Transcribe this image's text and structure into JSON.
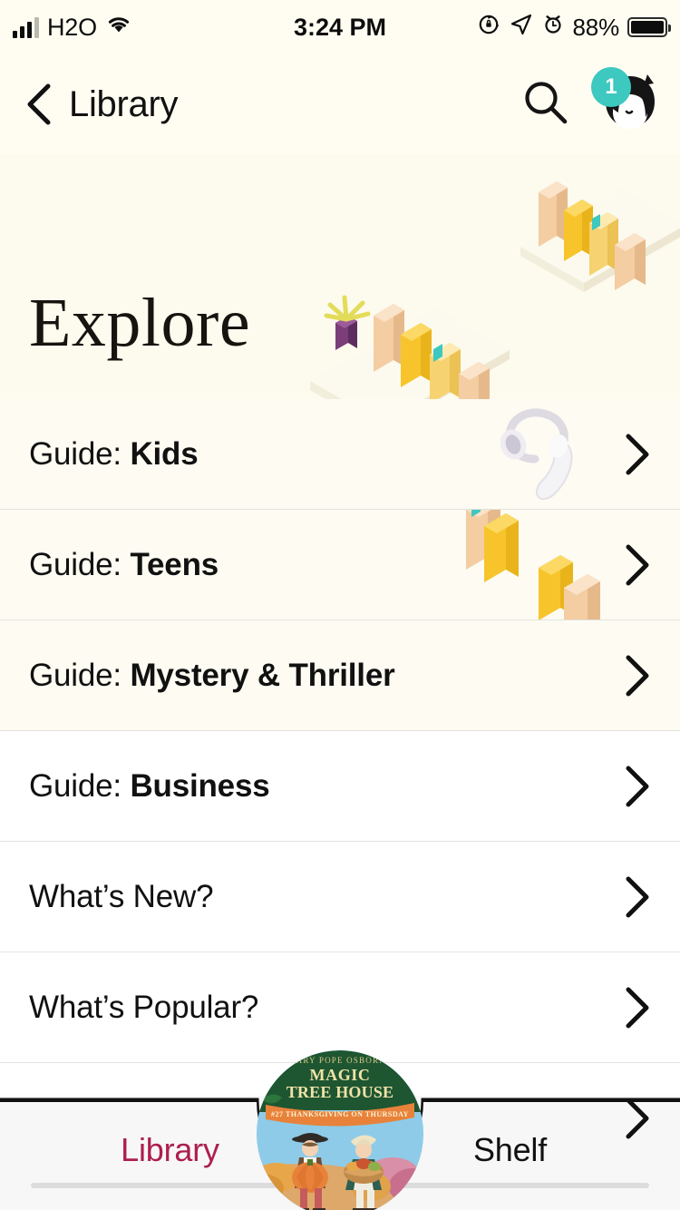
{
  "status_bar": {
    "carrier": "H2O",
    "time": "3:24 PM",
    "battery_percent": "88%",
    "icons": [
      "signal-bars-icon",
      "wifi-icon",
      "rotation-lock-icon",
      "location-arrow-icon",
      "alarm-clock-icon",
      "battery-icon"
    ]
  },
  "nav": {
    "back_label": "Library",
    "back_icon": "chevron-left-icon",
    "search_icon": "search-icon",
    "avatar_icon": "avatar-icon",
    "avatar_badge": "1",
    "badge_color": "#3DC8C0"
  },
  "hero": {
    "title": "Explore",
    "art_icon": "isometric-bookshelf-illustration",
    "background": "#FDFAEE"
  },
  "list": {
    "rows": [
      {
        "prefix": "Guide: ",
        "name": "Kids",
        "chevron": "chevron-right-icon",
        "art": "headphones-illustration",
        "bg": "cream"
      },
      {
        "prefix": "Guide: ",
        "name": "Teens",
        "chevron": "chevron-right-icon",
        "art": "books-illustration",
        "bg": "cream"
      },
      {
        "prefix": "Guide: ",
        "name": "Mystery & Thriller",
        "chevron": "chevron-right-icon",
        "art": "",
        "bg": "cream"
      },
      {
        "prefix": "Guide: ",
        "name": "Business",
        "chevron": "chevron-right-icon",
        "art": "",
        "bg": "plain"
      },
      {
        "prefix": "",
        "name": "What’s New?",
        "chevron": "chevron-right-icon",
        "art": "",
        "bg": "plain"
      },
      {
        "prefix": "",
        "name": "What’s Popular?",
        "chevron": "chevron-right-icon",
        "art": "",
        "bg": "plain"
      }
    ]
  },
  "tabbar": {
    "tabs": [
      {
        "label": "Library",
        "active": true,
        "color": "#AD1E4F"
      },
      {
        "label": "Shelf",
        "active": false,
        "color": "#111111"
      }
    ],
    "now_playing": {
      "icon": "book-cover-thumbnail",
      "series": "MAGIC TREE HOUSE",
      "author_line": "MARY POPE OSBORNE",
      "subtitle": "#27 THANKSGIVING ON THURSDAY"
    }
  },
  "colors": {
    "cream_bg": "#FDFBF2",
    "nav_bg": "#FFFDF2",
    "accent": "#AD1E4F",
    "teal": "#3DC8C0",
    "book_yellow": "#F7C52B",
    "book_peach": "#F3C79C",
    "divider": "#E3E3DE"
  }
}
